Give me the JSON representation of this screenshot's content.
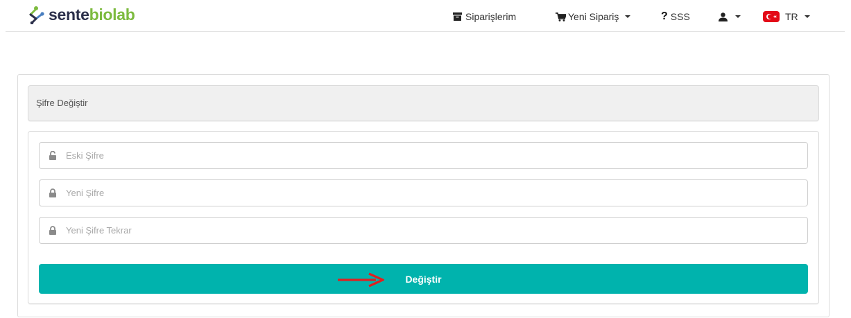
{
  "brand": {
    "part1": "sente",
    "part2": "biolab",
    "colors": {
      "dark": "#2b2f4a",
      "green": "#7dbb3f",
      "blue": "#4a7fc0"
    }
  },
  "nav": {
    "orders_label": "Siparişlerim",
    "orders_icon": "archive-icon",
    "new_order_label": "Yeni Sipariş",
    "new_order_icon": "cart-icon",
    "faq_label": "SSS",
    "faq_icon": "question-icon",
    "user_icon": "user-icon",
    "language_label": "TR",
    "language_icon": "turkey-flag-icon"
  },
  "panel": {
    "title": "Şifre Değiştir"
  },
  "form": {
    "old_password_placeholder": "Eski Şifre",
    "new_password_placeholder": "Yeni Şifre",
    "confirm_password_placeholder": "Yeni Şifre Tekrar",
    "submit_label": "Değiştir"
  },
  "colors": {
    "accent": "#00b3ad",
    "arrow": "#e02020",
    "flag": "#e30a17"
  }
}
